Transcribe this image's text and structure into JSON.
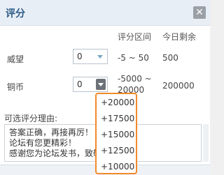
{
  "dialog": {
    "title": "评分",
    "close_glyph": "✕"
  },
  "columns": {
    "range": "评分区间",
    "remain": "今日剩余"
  },
  "rows": [
    {
      "label": "威望",
      "value": "0",
      "range": "-5 ~ 50",
      "remain": "500"
    },
    {
      "label": "铜币",
      "value": "0",
      "range_line1": "-5000 ~",
      "range_line2": "20000",
      "remain": "200000"
    }
  ],
  "reason": {
    "label": "可选评分理由:",
    "lines": [
      "答案正确，再接再厉！",
      "论坛有您更精彩！",
      "感谢您为论坛发书，致敬"
    ]
  },
  "dropdown_options": [
    "+20000",
    "+17500",
    "+15000",
    "+12500",
    "+10000"
  ],
  "colors": {
    "accent": "#2b5a88",
    "highlight": "#f28a2b"
  }
}
